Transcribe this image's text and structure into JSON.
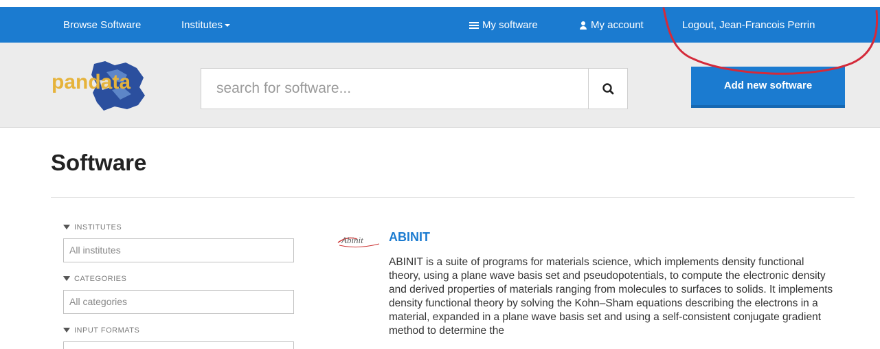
{
  "topnav": {
    "browse": "Browse Software",
    "institutes": "Institutes",
    "my_software": "My software",
    "my_account": "My account",
    "logout": "Logout, Jean-Francois Perrin"
  },
  "search": {
    "placeholder": "search for software...",
    "add_button": "Add new software"
  },
  "logo": {
    "text": "pandata"
  },
  "page": {
    "title": "Software"
  },
  "filters": [
    {
      "label": "INSTITUTES",
      "value": "All institutes"
    },
    {
      "label": "CATEGORIES",
      "value": "All categories"
    },
    {
      "label": "INPUT FORMATS",
      "value": ""
    }
  ],
  "software": [
    {
      "logo_text": "Abinit",
      "name": "ABINIT",
      "description": "ABINIT is a suite of programs for materials science, which implements density functional theory, using a plane wave basis set and pseudopotentials, to compute the electronic density and derived properties of materials ranging from molecules to surfaces to solids. It implements density functional theory by solving the Kohn–Sham equations describing the electrons in a material, expanded in a plane wave basis set and using a self-consistent conjugate gradient method to determine the"
    }
  ],
  "colors": {
    "brand_blue": "#1b7bd0",
    "annotation_red": "#d42a3a"
  }
}
